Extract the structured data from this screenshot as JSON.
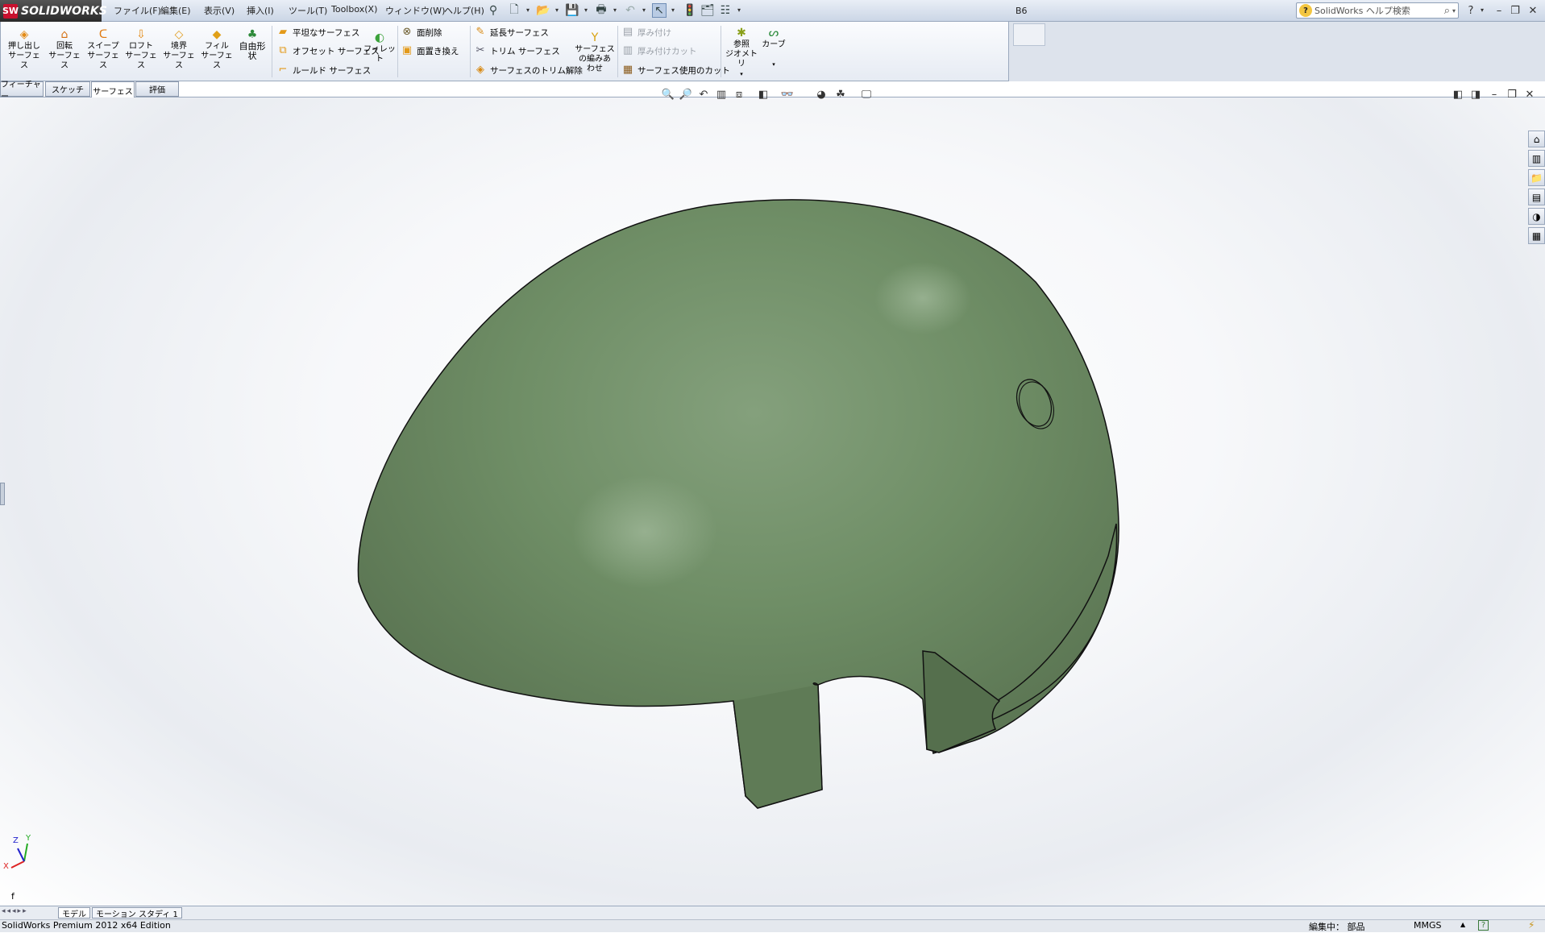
{
  "app": {
    "logo_text": "SOLIDWORKS",
    "logo_mark": "SW",
    "doc_title": "B6"
  },
  "menu": [
    "ファイル(F)",
    "編集(E)",
    "表示(V)",
    "挿入(I)",
    "ツール(T)",
    "Toolbox(X)",
    "ウィンドウ(W)",
    "ヘルプ(H)"
  ],
  "search": {
    "placeholder": "SolidWorks ヘルプ検索",
    "help_glyph": "?"
  },
  "toolbar": {
    "big_buttons": [
      {
        "l1": "押し出し",
        "l2": "サーフェス"
      },
      {
        "l1": "回転",
        "l2": "サーフェス"
      },
      {
        "l1": "スイープ",
        "l2": "サーフェス"
      },
      {
        "l1": "ロフト",
        "l2": "サーフェス"
      },
      {
        "l1": "境界",
        "l2": "サーフェス"
      },
      {
        "l1": "フィル",
        "l2": "サーフェス"
      },
      {
        "l1": "自由形",
        "l2": "状"
      }
    ],
    "col1": [
      "平坦なサーフェス",
      "オフセット サーフェス",
      "ルールド サーフェス"
    ],
    "fillet": "フィレット",
    "col2": [
      "面削除",
      "面置き換え"
    ],
    "col3": [
      "延長サーフェス",
      "トリム サーフェス",
      "サーフェスのトリム解除"
    ],
    "knit": {
      "l1": "サーフェス",
      "l2": "の編みあ",
      "l3": "わせ"
    },
    "col4": [
      "厚み付け",
      "厚み付けカット",
      "サーフェス使用のカット"
    ],
    "ref_geom": {
      "l1": "参照",
      "l2": "ジオメトリ"
    },
    "curves": "カーブ"
  },
  "tabs": [
    "フィーチャー",
    "スケッチ",
    "サーフェス",
    "評価"
  ],
  "active_tab": 2,
  "bottom_tabs": [
    "モデル",
    "モーション スタディ 1"
  ],
  "triad": {
    "x": "X",
    "y": "Y",
    "z": "Z"
  },
  "viewport_label": "f",
  "status": {
    "left": "SolidWorks Premium 2012 x64 Edition",
    "editing": "編集中： 部品",
    "units": "MMGS",
    "units_arrow": "▲",
    "help_glyph": "?"
  },
  "colors": {
    "part": "#6b8a62",
    "brand": "#c8102e"
  }
}
